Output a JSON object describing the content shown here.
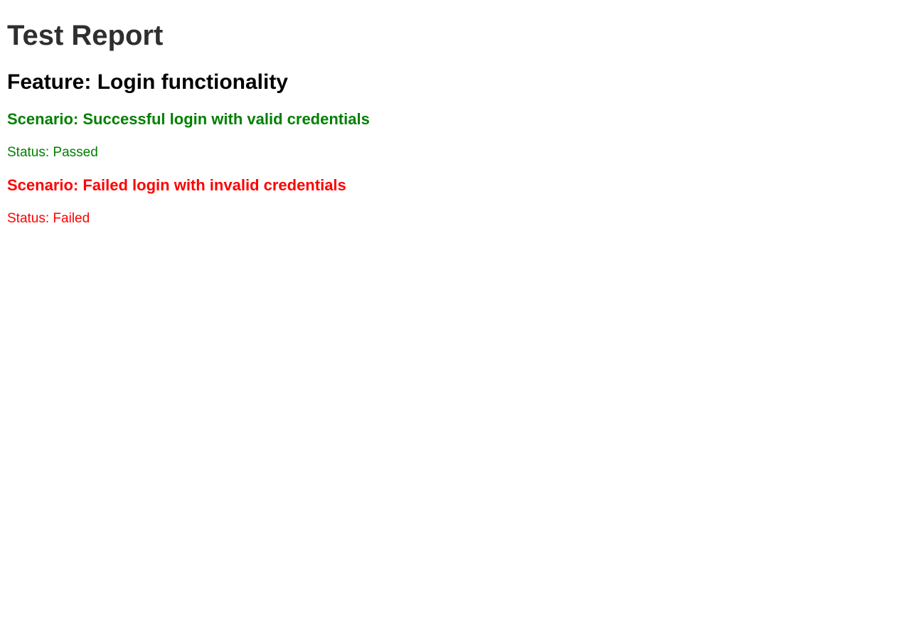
{
  "report": {
    "title": "Test Report"
  },
  "feature": {
    "title": "Feature: Login functionality"
  },
  "scenarios": [
    {
      "title": "Scenario: Successful login with valid credentials",
      "status": "Status: Passed",
      "color": "#008000"
    },
    {
      "title": "Scenario: Failed login with invalid credentials",
      "status": "Status: Failed",
      "color": "#ff0000"
    }
  ]
}
